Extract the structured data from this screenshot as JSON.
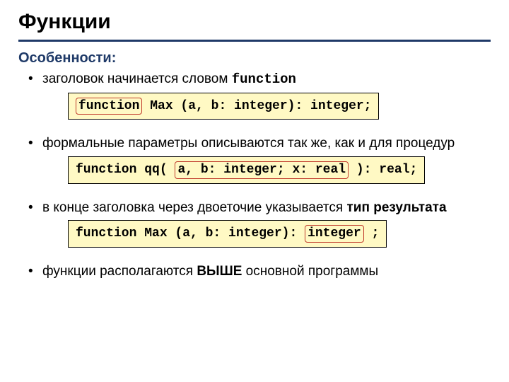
{
  "title": "Функции",
  "subtitle": "Особенности:",
  "bullets": {
    "b1_pre": "заголовок начинается словом ",
    "b1_kw": "function",
    "b2": "формальные параметры описываются так же, как и для процедур",
    "b3_pre": "в конце заголовка через двоеточие указывается ",
    "b3_bold": "тип результата",
    "b4_pre": "функции располагаются ",
    "b4_caps": "ВЫШЕ",
    "b4_post": " основной программы"
  },
  "code1": {
    "hl": "function",
    "rest": " Max (a, b: integer): integer;"
  },
  "code2": {
    "pre": "function qq( ",
    "hl": "a, b: integer; x: real",
    "post": " ): real;"
  },
  "code3": {
    "pre": "function Max (a, b: integer): ",
    "hl": "integer",
    "post": " ;"
  }
}
